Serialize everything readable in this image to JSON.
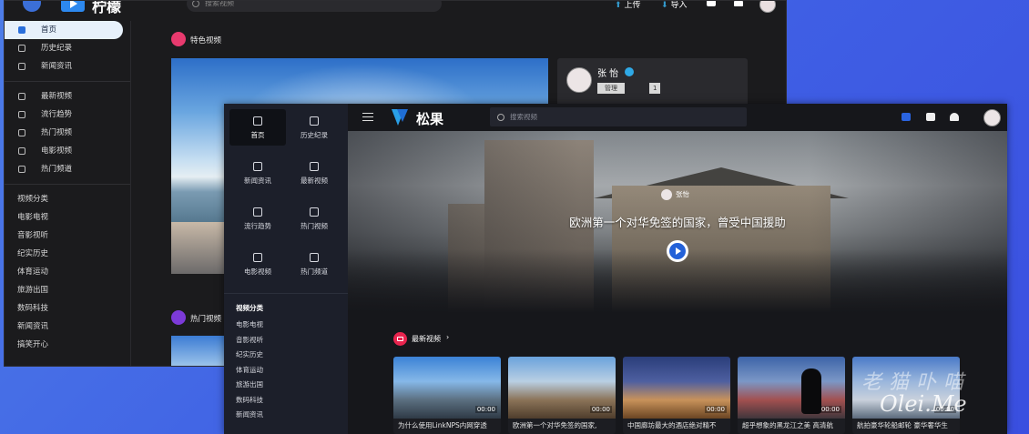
{
  "back_window": {
    "brand": "柠檬",
    "search_placeholder": "搜索视频",
    "upload_label": "上传",
    "import_label": "导入",
    "nav": [
      {
        "label": "首页",
        "icon": "home-icon",
        "active": true
      },
      {
        "label": "历史纪录",
        "icon": "history-icon"
      },
      {
        "label": "新闻资讯",
        "icon": "news-icon"
      }
    ],
    "nav2": [
      {
        "label": "最新视频",
        "icon": "video-icon"
      },
      {
        "label": "流行趋势",
        "icon": "trend-icon"
      },
      {
        "label": "热门视频",
        "icon": "chart-icon"
      },
      {
        "label": "电影视频",
        "icon": "film-icon"
      },
      {
        "label": "热门频道",
        "icon": "star-icon"
      }
    ],
    "categories": [
      "视频分类",
      "电影电视",
      "音影视听",
      "纪实历史",
      "体育运动",
      "旅游出国",
      "数码科技",
      "新闻资讯",
      "搞笑开心"
    ],
    "featured_title": "特色视频",
    "hot_title": "热门视频",
    "profile": {
      "name": "张 怡",
      "role": "管理",
      "level": "1"
    }
  },
  "front_window": {
    "brand": "松果",
    "search_placeholder": "搜索视频",
    "grid_nav": [
      {
        "label": "首页",
        "icon": "home-icon",
        "active": true
      },
      {
        "label": "历史纪录",
        "icon": "history-icon"
      },
      {
        "label": "新闻资讯",
        "icon": "news-icon"
      },
      {
        "label": "最新视频",
        "icon": "video-icon"
      },
      {
        "label": "流行趋势",
        "icon": "fire-icon"
      },
      {
        "label": "热门视频",
        "icon": "chart-icon"
      },
      {
        "label": "电影视频",
        "icon": "film-icon"
      },
      {
        "label": "热门频道",
        "icon": "star-icon"
      }
    ],
    "categories_title": "视频分类",
    "categories": [
      "电影电视",
      "音影视听",
      "纪实历史",
      "体育运动",
      "旅游出国",
      "数码科技",
      "新闻资讯"
    ],
    "hero": {
      "user": "张怡",
      "title": "欧洲第一个对华免签的国家，曾受中国援助"
    },
    "latest_title": "最新视频",
    "videos": [
      {
        "title": "为什么使用LinkNPS内网穿透",
        "duration": "00:00"
      },
      {
        "title": "欧洲第一个对华免签的国家,",
        "duration": "00:00"
      },
      {
        "title": "中国廊坊最大的酒店绝对精不",
        "duration": "00:00"
      },
      {
        "title": "超乎想象的黑龙江之美 高清航",
        "duration": "00:00"
      },
      {
        "title": "航拍豪华轮船邮轮 豪华奢华生",
        "duration": "00:00"
      }
    ],
    "colors": {
      "accent": "#2361d8",
      "latest_badge": "#e8244e"
    }
  },
  "watermark": {
    "cn": "老猫卟喵",
    "en": "Olei.Me"
  }
}
